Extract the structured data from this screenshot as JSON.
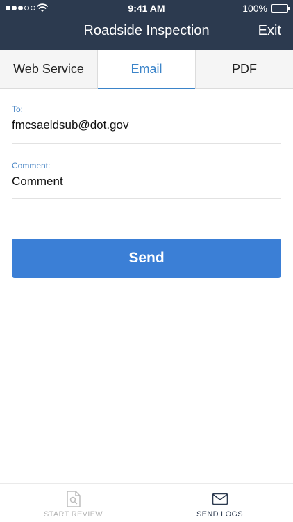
{
  "status_bar": {
    "time": "9:41 AM",
    "battery": "100%",
    "signal_bars_filled": 3,
    "signal_bars_total": 5
  },
  "nav": {
    "title": "Roadside Inspection",
    "exit_label": "Exit"
  },
  "tabs": [
    {
      "label": "Web Service",
      "active": false
    },
    {
      "label": "Email",
      "active": true
    },
    {
      "label": "PDF",
      "active": false
    }
  ],
  "form": {
    "to_label": "To:",
    "to_value": "fmcsaeldsub@dot.gov",
    "comment_label": "Comment:",
    "comment_placeholder": "Comment",
    "send_label": "Send"
  },
  "tabbar": [
    {
      "label": "START REVIEW",
      "icon": "review-document-icon",
      "active": false
    },
    {
      "label": "SEND LOGS",
      "icon": "envelope-icon",
      "active": true
    }
  ],
  "colors": {
    "header_bg": "#2c3a4f",
    "accent": "#3b84c9",
    "button_bg": "#3b7fd6",
    "label": "#4a86c5"
  }
}
